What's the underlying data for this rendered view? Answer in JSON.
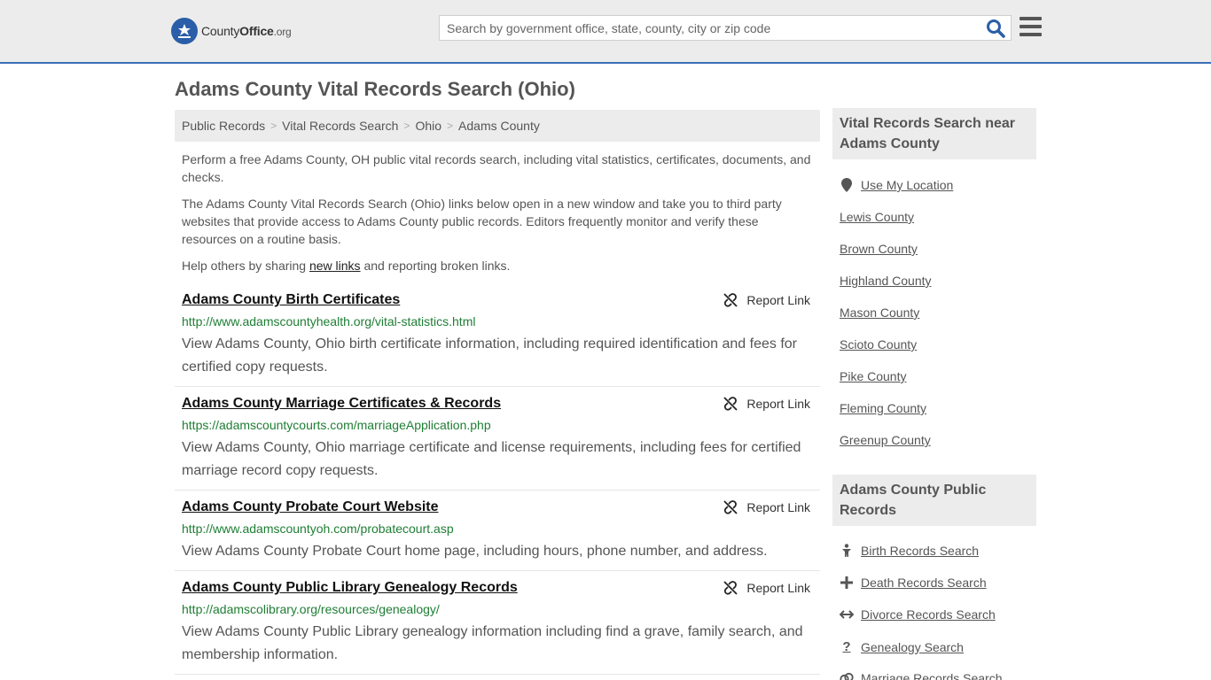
{
  "header": {
    "logo_brand_a": "County",
    "logo_brand_b": "Office",
    "logo_suffix": ".org",
    "search_placeholder": "Search by government office, state, county, city or zip code"
  },
  "page_title": "Adams County Vital Records Search (Ohio)",
  "breadcrumb": [
    "Public Records",
    "Vital Records Search",
    "Ohio",
    "Adams County"
  ],
  "intro": {
    "p1": "Perform a free Adams County, OH public vital records search, including vital statistics, certificates, documents, and checks.",
    "p2": "The Adams County Vital Records Search (Ohio) links below open in a new window and take you to third party websites that provide access to Adams County public records. Editors frequently monitor and verify these resources on a routine basis.",
    "p3_before": "Help others by sharing ",
    "p3_link": "new links",
    "p3_after": " and reporting broken links."
  },
  "report_label": "Report Link",
  "listings": [
    {
      "title": "Adams County Birth Certificates",
      "url": "http://www.adamscountyhealth.org/vital-statistics.html",
      "desc": "View Adams County, Ohio birth certificate information, including required identification and fees for certified copy requests."
    },
    {
      "title": "Adams County Marriage Certificates & Records",
      "url": "https://adamscountycourts.com/marriageApplication.php",
      "desc": "View Adams County, Ohio marriage certificate and license requirements, including fees for certified marriage record copy requests."
    },
    {
      "title": "Adams County Probate Court Website",
      "url": "http://www.adamscountyoh.com/probatecourt.asp",
      "desc": "View Adams County Probate Court home page, including hours, phone number, and address."
    },
    {
      "title": "Adams County Public Library Genealogy Records",
      "url": "http://adamscolibrary.org/resources/genealogy/",
      "desc": "View Adams County Public Library genealogy information including find a grave, family search, and membership information."
    }
  ],
  "sidebar": {
    "nearby_title": "Vital Records Search near Adams County",
    "use_location": "Use My Location",
    "nearby": [
      "Lewis County",
      "Brown County",
      "Highland County",
      "Mason County",
      "Scioto County",
      "Pike County",
      "Fleming County",
      "Greenup County"
    ],
    "public_title": "Adams County Public Records",
    "public_links": [
      {
        "label": "Birth Records Search",
        "icon": "person-icon"
      },
      {
        "label": "Death Records Search",
        "icon": "cross-icon"
      },
      {
        "label": "Divorce Records Search",
        "icon": "split-arrows-icon"
      },
      {
        "label": "Genealogy Search",
        "icon": "question-icon"
      },
      {
        "label": "Marriage Records Search",
        "icon": "rings-icon"
      }
    ]
  }
}
